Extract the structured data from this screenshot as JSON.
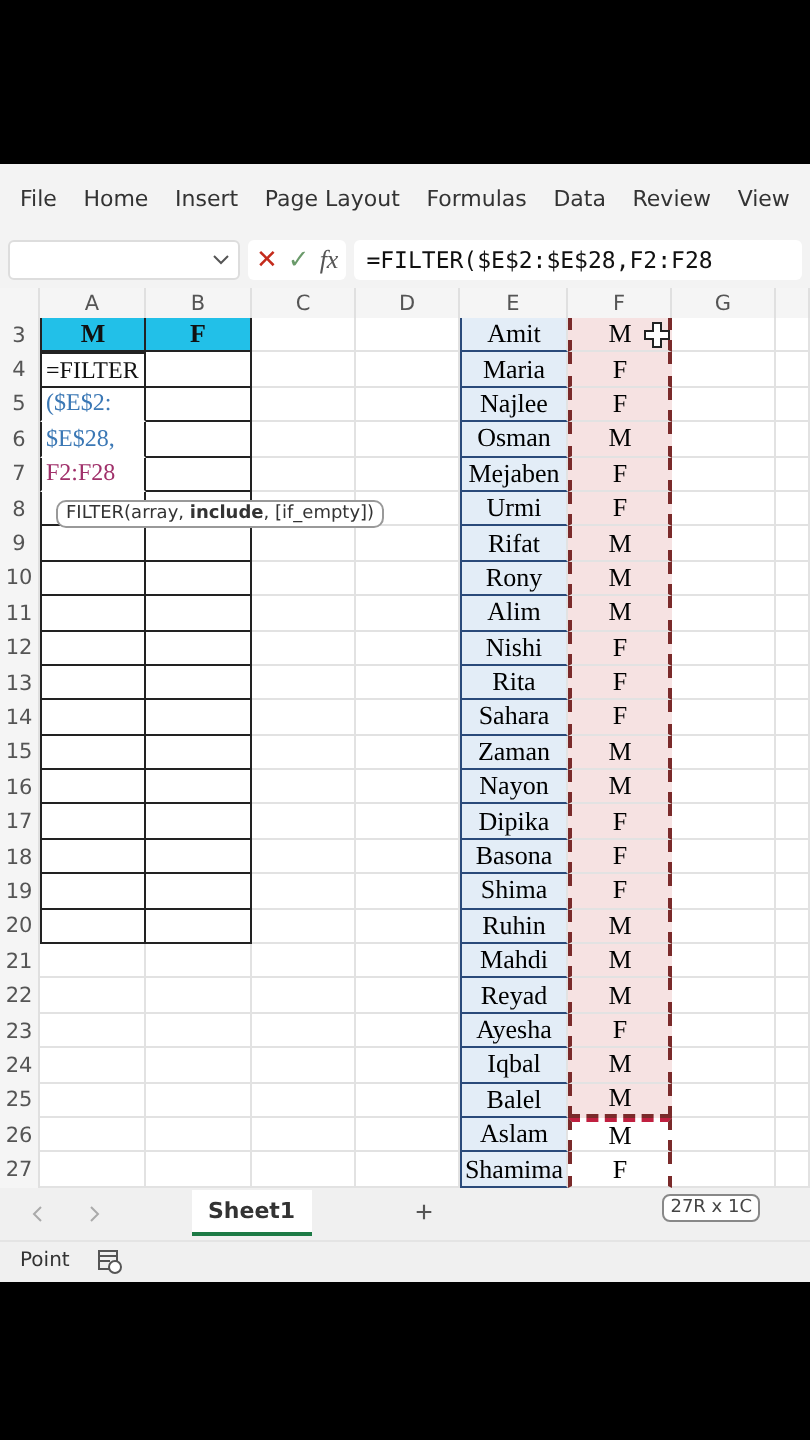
{
  "ribbon": {
    "tabs": [
      {
        "label": "File"
      },
      {
        "label": "Home"
      },
      {
        "label": "Insert"
      },
      {
        "label": "Page Layout"
      },
      {
        "label": "Formulas"
      },
      {
        "label": "Data"
      },
      {
        "label": "Review"
      },
      {
        "label": "View"
      }
    ]
  },
  "formula_bar": {
    "cancel": "✕",
    "enter": "✓",
    "fx": "fx",
    "formula": "=FILTER($E$2:$E$28,F2:F28"
  },
  "columns": [
    "A",
    "B",
    "C",
    "D",
    "E",
    "F",
    "G"
  ],
  "edit_lines": [
    {
      "text": "=FILTER",
      "color": "#111111"
    },
    {
      "text": "($E$2:",
      "color": "#3b78b5"
    },
    {
      "text": "$E$28,",
      "color": "#3b78b5"
    },
    {
      "text": "F2:F28",
      "color": "#a0306a"
    }
  ],
  "tooltip": "FILTER(array, **include**, [if_empty])",
  "rows": [
    {
      "number": "3",
      "a": "M",
      "b": "F",
      "name": "Amit",
      "gender": "M",
      "copied": true
    },
    {
      "number": "4",
      "name": "Maria",
      "gender": "F",
      "copied": true
    },
    {
      "number": "5",
      "name": "Najlee",
      "gender": "F",
      "copied": true
    },
    {
      "number": "6",
      "name": "Osman",
      "gender": "M",
      "copied": true
    },
    {
      "number": "7",
      "name": "Mejaben",
      "gender": "F",
      "copied": true
    },
    {
      "number": "8",
      "name": "Urmi",
      "gender": "F",
      "copied": true
    },
    {
      "number": "9",
      "name": "Rifat",
      "gender": "M",
      "copied": true
    },
    {
      "number": "10",
      "name": "Rony",
      "gender": "M",
      "copied": true
    },
    {
      "number": "11",
      "name": "Alim",
      "gender": "M",
      "copied": true
    },
    {
      "number": "12",
      "name": "Nishi",
      "gender": "F",
      "copied": true
    },
    {
      "number": "13",
      "name": "Rita",
      "gender": "F",
      "copied": true
    },
    {
      "number": "14",
      "name": "Sahara",
      "gender": "F",
      "copied": true
    },
    {
      "number": "15",
      "name": "Zaman",
      "gender": "M",
      "copied": true
    },
    {
      "number": "16",
      "name": "Nayon",
      "gender": "M",
      "copied": true
    },
    {
      "number": "17",
      "name": "Dipika",
      "gender": "F",
      "copied": true
    },
    {
      "number": "18",
      "name": "Basona",
      "gender": "F",
      "copied": true
    },
    {
      "number": "19",
      "name": "Shima",
      "gender": "F",
      "copied": true
    },
    {
      "number": "20",
      "name": "Ruhin",
      "gender": "M",
      "copied": true
    },
    {
      "number": "21",
      "name": "Mahdi",
      "gender": "M",
      "copied": true
    },
    {
      "number": "22",
      "name": "Reyad",
      "gender": "M",
      "copied": true
    },
    {
      "number": "23",
      "name": "Ayesha",
      "gender": "F",
      "copied": true
    },
    {
      "number": "24",
      "name": "Iqbal",
      "gender": "M",
      "copied": true
    },
    {
      "number": "25",
      "name": "Balel",
      "gender": "M",
      "copied": true
    },
    {
      "number": "26",
      "name": "Aslam",
      "gender": "M",
      "copied": false
    },
    {
      "number": "27",
      "name": "Shamima",
      "gender": "F",
      "copied": false
    }
  ],
  "sheet_tabs": [
    {
      "label": "Sheet1",
      "selected": true
    }
  ],
  "add_sheet": "+",
  "selection_size": "27R x 1C",
  "status": "Point"
}
